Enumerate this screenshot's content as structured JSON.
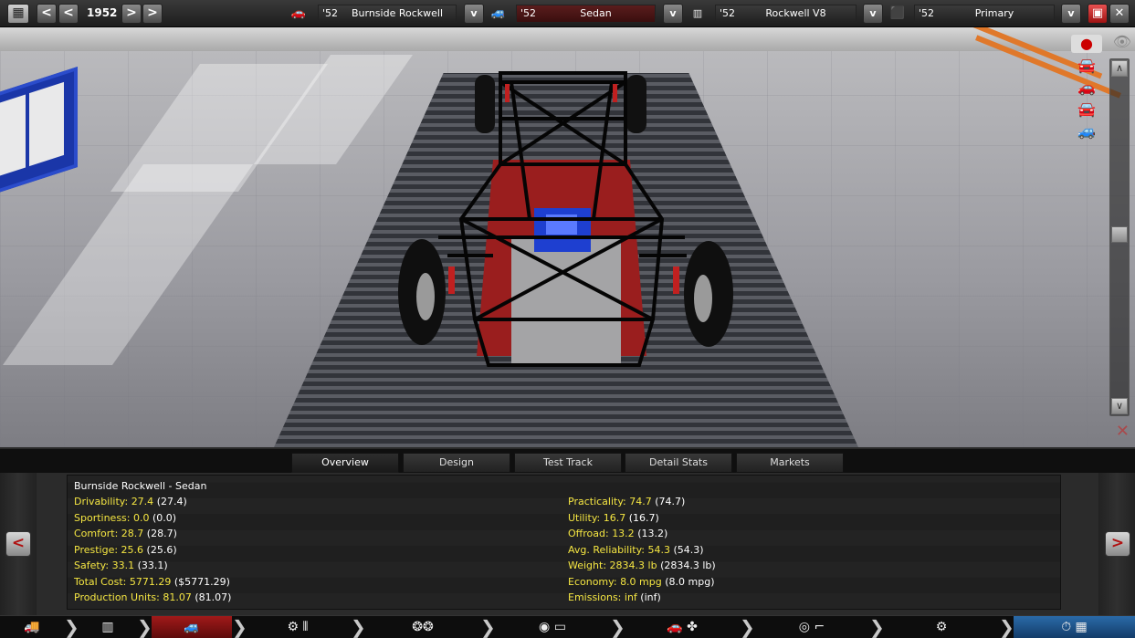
{
  "topbar": {
    "year": "1952",
    "prev_label": "<",
    "next_label": ">",
    "dropdown_label": "v",
    "selectors": [
      {
        "year": "'52",
        "name": "Burnside Rockwell"
      },
      {
        "year": "'52",
        "name": "Sedan"
      },
      {
        "year": "'52",
        "name": "Rockwell V8"
      },
      {
        "year": "'52",
        "name": "Primary"
      }
    ]
  },
  "tabs": [
    "Overview",
    "Design",
    "Test Track",
    "Detail Stats",
    "Markets"
  ],
  "active_tab": "Overview",
  "stats": {
    "title": "Burnside Rockwell - Sedan",
    "left": [
      {
        "label": "Drivability:",
        "value": "27.4",
        "paren": "(27.4)"
      },
      {
        "label": "Sportiness:",
        "value": "0.0",
        "paren": "(0.0)"
      },
      {
        "label": "Comfort:",
        "value": "28.7",
        "paren": "(28.7)"
      },
      {
        "label": "Prestige:",
        "value": "25.6",
        "paren": "(25.6)"
      },
      {
        "label": "Safety:",
        "value": "33.1",
        "paren": "(33.1)"
      },
      {
        "label": "Total Cost:",
        "value": "5771.29",
        "paren": "($5771.29)"
      },
      {
        "label": "Production Units:",
        "value": "81.07",
        "paren": "(81.07)"
      }
    ],
    "right": [
      {
        "label": "Practicality:",
        "value": "74.7",
        "paren": "(74.7)"
      },
      {
        "label": "Utility:",
        "value": "16.7",
        "paren": "(16.7)"
      },
      {
        "label": "Offroad:",
        "value": "13.2",
        "paren": "(13.2)"
      },
      {
        "label": "Avg. Reliability:",
        "value": "54.3",
        "paren": "(54.3)"
      },
      {
        "label": "Weight:",
        "value": "2834.3 lb",
        "paren": "(2834.3 lb)"
      },
      {
        "label": "Economy:",
        "value": "8.0 mpg",
        "paren": "(8.0 mpg)"
      },
      {
        "label": "Emissions:",
        "value": "inf",
        "paren": "(inf)"
      }
    ]
  },
  "panel_nav": {
    "prev_label": "<",
    "next_label": ">"
  },
  "colors": {
    "stat_yellow": "#f5e642",
    "active_red": "#a11a1a",
    "selector_bg": "#5a1d1d"
  },
  "bottombar_icons": [
    "car-body-icon",
    "chassis-icon",
    "car-model-icon",
    "engine-gearbox-icon",
    "wheels-icon",
    "brakes-icon",
    "car-design-icon",
    "fan-icon",
    "steering-interior-icon",
    "suspension-icon",
    "finish-icon"
  ]
}
